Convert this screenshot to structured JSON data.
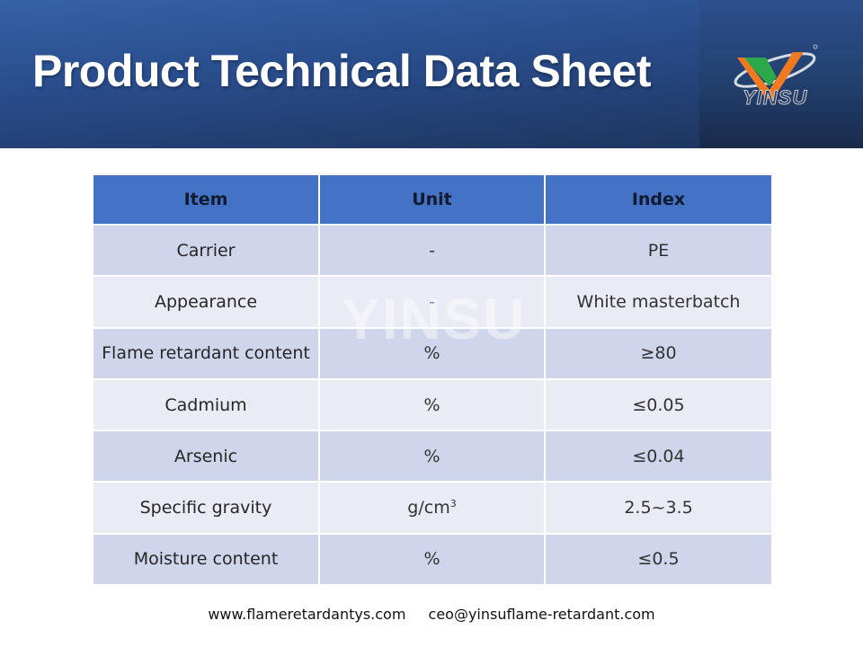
{
  "header": {
    "title": "Product Technical Data Sheet",
    "logo_text": "YINSU"
  },
  "watermark": "YINSU",
  "table": {
    "headers": [
      "Item",
      "Unit",
      "Index"
    ],
    "rows": [
      {
        "item": "Carrier",
        "unit": "-",
        "index": "PE"
      },
      {
        "item": "Appearance",
        "unit": "-",
        "index": "White masterbatch"
      },
      {
        "item": "Flame retardant content",
        "unit": "%",
        "index": "≥80"
      },
      {
        "item": "Cadmium",
        "unit": "%",
        "index": "≤0.05"
      },
      {
        "item": "Arsenic",
        "unit": "%",
        "index": "≤0.04"
      },
      {
        "item": "Specific gravity",
        "unit": "g/cm",
        "unit_sup": "3",
        "index": "2.5~3.5"
      },
      {
        "item": "Moisture content",
        "unit": "%",
        "index": "≤0.5"
      }
    ]
  },
  "footer": {
    "website": "www.flameretardantys.com",
    "email": "ceo@yinsuflame-retardant.com"
  },
  "colors": {
    "header_blue": "#2f5597",
    "table_header": "#4472c4",
    "row_odd": "#cfd5ea",
    "row_even": "#e9ebf5",
    "logo_green": "#2aa84a",
    "logo_orange": "#f07a22"
  }
}
